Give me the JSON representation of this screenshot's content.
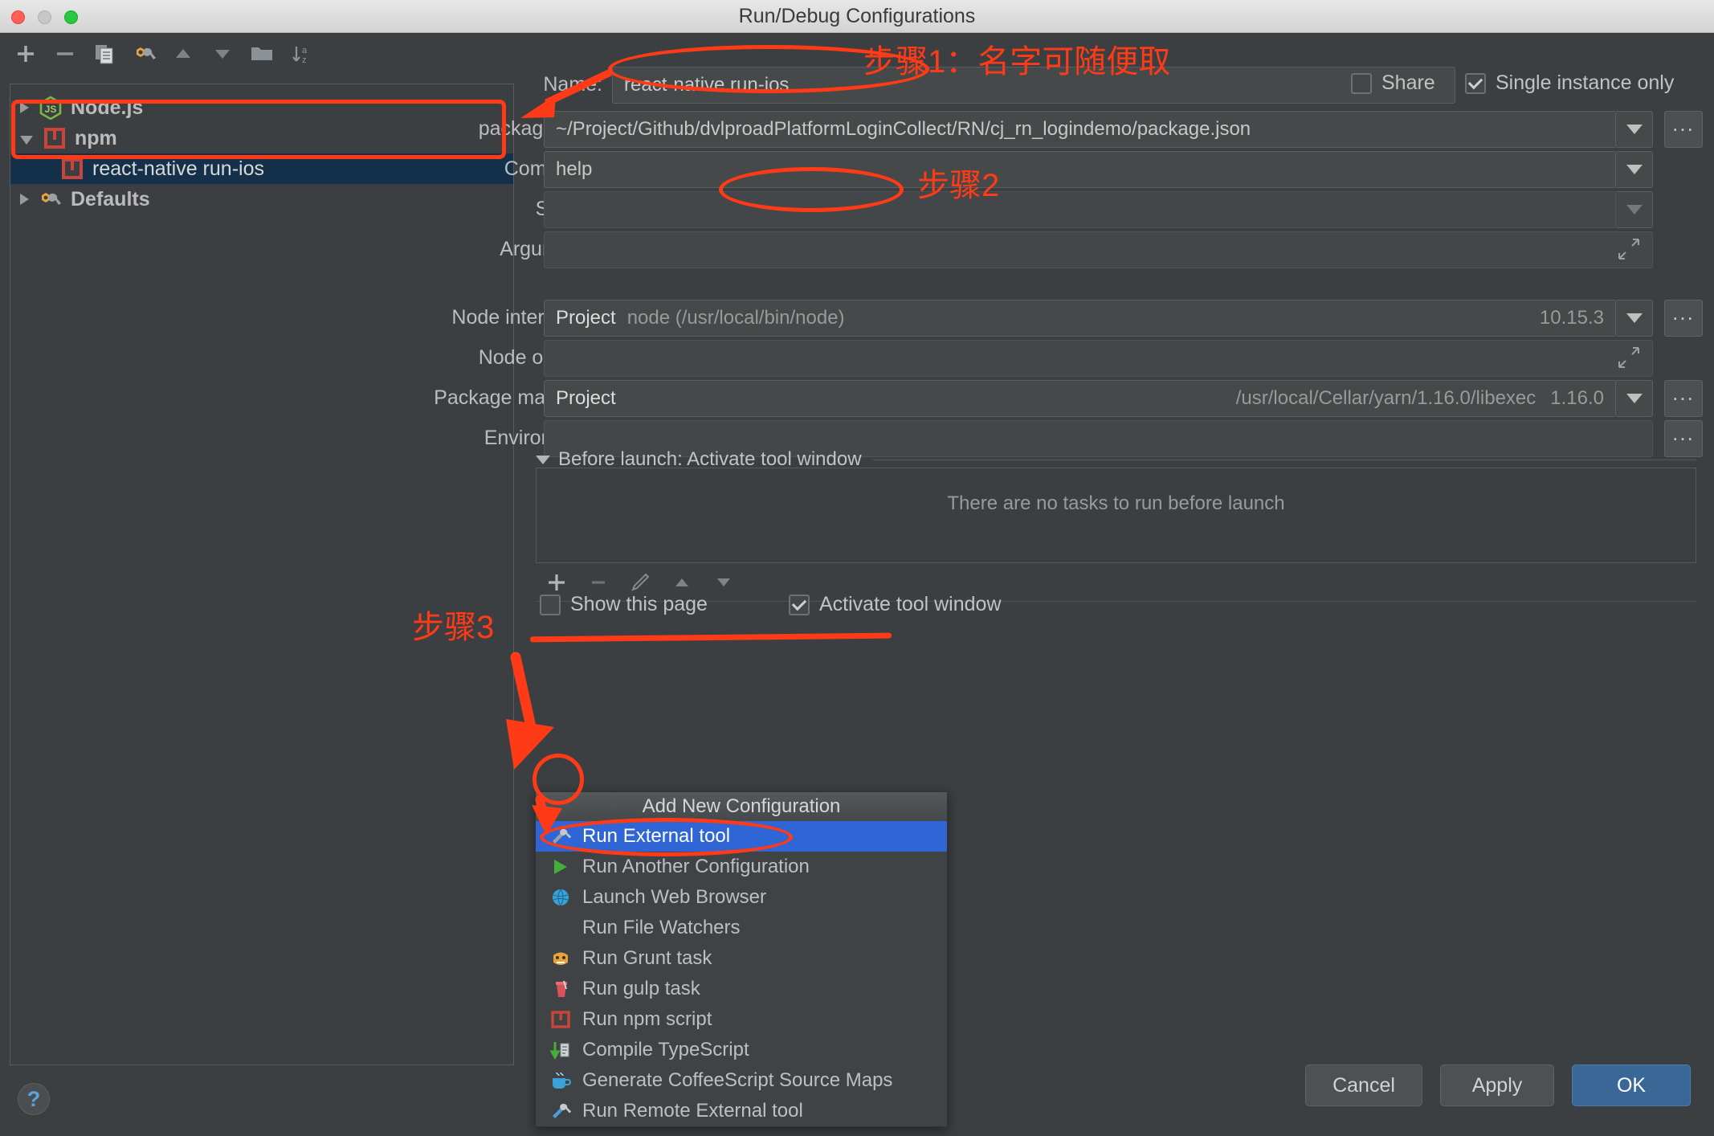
{
  "window": {
    "title": "Run/Debug Configurations",
    "traffic_lights": [
      "close-button",
      "minimize-button",
      "maximize-button"
    ]
  },
  "sidebar": {
    "toolbar": [
      {
        "name": "add-configuration-button",
        "icon": "plus-icon"
      },
      {
        "name": "remove-configuration-button",
        "icon": "minus-icon"
      },
      {
        "name": "copy-configuration-button",
        "icon": "copy-icon"
      },
      {
        "name": "edit-defaults-button",
        "icon": "wrench-icon"
      },
      {
        "name": "move-up-button",
        "icon": "triangle-up-icon"
      },
      {
        "name": "move-down-button",
        "icon": "triangle-down-icon"
      },
      {
        "name": "new-folder-button",
        "icon": "folder-icon"
      },
      {
        "name": "sort-configurations-button",
        "icon": "sort-az-icon"
      }
    ],
    "tree": [
      {
        "label": "Node.js",
        "icon": "nodejs-icon",
        "level": 0,
        "expanded": false,
        "selected": false
      },
      {
        "label": "npm",
        "icon": "npm-icon",
        "level": 0,
        "expanded": true,
        "selected": false
      },
      {
        "label": "react-native run-ios",
        "icon": "npm-icon",
        "level": 1,
        "expanded": null,
        "selected": true
      },
      {
        "label": "Defaults",
        "icon": "wrench-icon",
        "level": 0,
        "expanded": false,
        "selected": false
      }
    ]
  },
  "form": {
    "name": {
      "label": "Name:",
      "value": "react-native run-ios"
    },
    "share": {
      "label": "Share",
      "checked": false
    },
    "single_instance": {
      "label": "Single instance only",
      "checked": true
    },
    "package_json": {
      "label": "package.json:",
      "value": "~/Project/Github/dvlproadPlatformLoginCollect/RN/cj_rn_logindemo/package.json",
      "browse_label": "...",
      "dropdown_icon": "chevron-down-icon"
    },
    "command": {
      "label": "Command:",
      "value": "help",
      "dropdown_icon": "chevron-down-icon"
    },
    "scripts": {
      "label": "Scripts:",
      "value": "",
      "dropdown_icon": "chevron-down-icon"
    },
    "arguments": {
      "label": "Arguments:",
      "value": "",
      "expand_icon": "expand-icon"
    },
    "node_interpreter": {
      "label": "Node interpreter:",
      "value": "Project",
      "detail": "node (/usr/local/bin/node)",
      "version": "10.15.3",
      "browse_label": "...",
      "dropdown_icon": "chevron-down-icon"
    },
    "node_options": {
      "label": "Node options:",
      "value": "",
      "expand_icon": "expand-icon"
    },
    "package_manager": {
      "label": "Package manager:",
      "value": "Project",
      "detail": "/usr/local/Cellar/yarn/1.16.0/libexec",
      "version": "1.16.0",
      "browse_label": "...",
      "dropdown_icon": "chevron-down-icon"
    },
    "environment": {
      "label": "Environment:",
      "value": "",
      "browse_label": "..."
    }
  },
  "before_launch": {
    "title": "Before launch: Activate tool window",
    "collapse_icon": "triangle-down-icon",
    "empty_text": "There are no tasks to run before launch",
    "toolbar": [
      {
        "name": "add-task-button",
        "icon": "plus-icon"
      },
      {
        "name": "remove-task-button",
        "icon": "minus-icon"
      },
      {
        "name": "edit-task-button",
        "icon": "pencil-icon"
      },
      {
        "name": "move-task-up-button",
        "icon": "triangle-up-icon"
      },
      {
        "name": "move-task-down-button",
        "icon": "triangle-down-icon"
      }
    ],
    "options": [
      {
        "label": "Show this page",
        "checked": false
      },
      {
        "label": "Activate tool window",
        "checked": true
      }
    ]
  },
  "add_menu": {
    "title": "Add New Configuration",
    "items": [
      {
        "label": "Run External tool",
        "icon": "hammer-wrench-icon",
        "selected": true
      },
      {
        "label": "Run Another Configuration",
        "icon": "green-play-icon",
        "selected": false
      },
      {
        "label": "Launch Web Browser",
        "icon": "globe-icon",
        "selected": false
      },
      {
        "label": "Run File Watchers",
        "icon": "none",
        "selected": false
      },
      {
        "label": "Run Grunt task",
        "icon": "grunt-icon",
        "selected": false
      },
      {
        "label": "Run gulp task",
        "icon": "gulp-icon",
        "selected": false
      },
      {
        "label": "Run npm script",
        "icon": "npm-icon",
        "selected": false
      },
      {
        "label": "Compile TypeScript",
        "icon": "typescript-icon",
        "selected": false
      },
      {
        "label": "Generate CoffeeScript Source Maps",
        "icon": "coffeescript-icon",
        "selected": false
      },
      {
        "label": "Run Remote External tool",
        "icon": "remote-hammer-wrench-icon",
        "selected": false
      }
    ]
  },
  "footer": {
    "help_label": "?",
    "cancel_label": "Cancel",
    "apply_label": "Apply",
    "ok_label": "OK"
  },
  "annotations": {
    "step1": "步骤1：名字可随便取",
    "step2": "步骤2",
    "step3": "步骤3",
    "color": "#ff3b17"
  }
}
